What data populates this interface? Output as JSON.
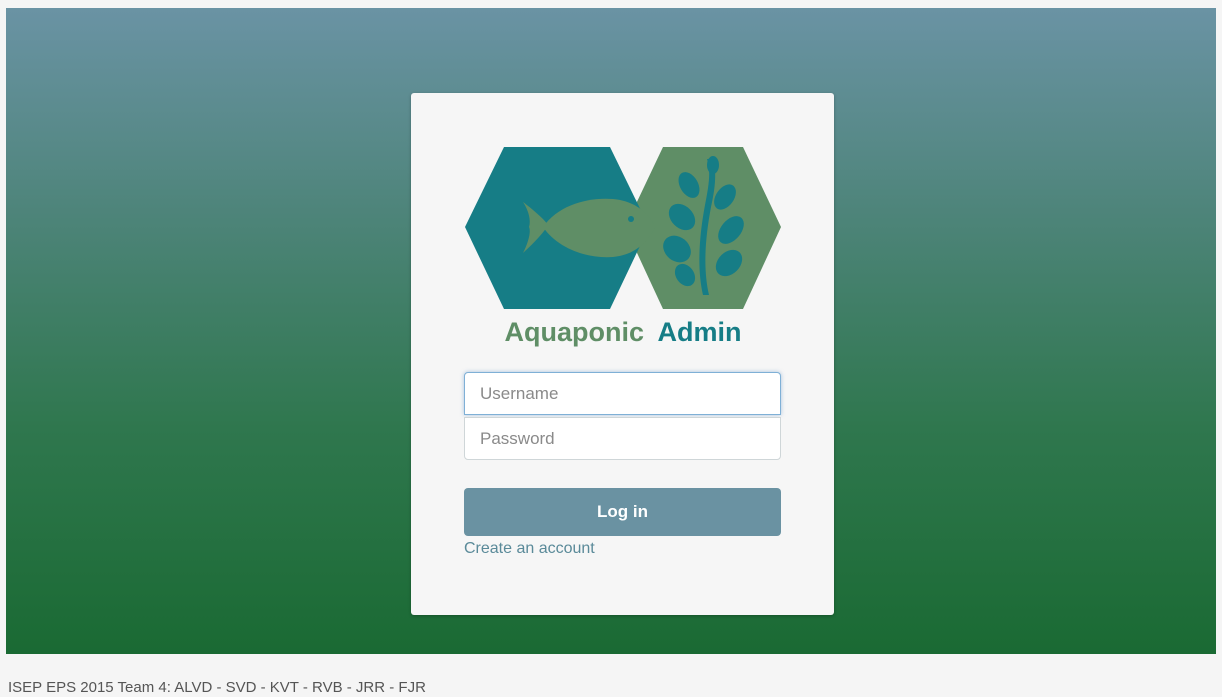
{
  "app": {
    "logo_text_part1": "Aquaponic",
    "logo_text_part2": "Admin",
    "logo_icons": [
      "fish-icon",
      "seaweed-icon"
    ]
  },
  "login_form": {
    "username_placeholder": "Username",
    "username_value": "",
    "password_placeholder": "Password",
    "password_value": "",
    "login_label": "Log in",
    "create_account_label": "Create an account"
  },
  "footer": {
    "text": "ISEP EPS 2015 Team 4: ALVD - SVD - KVT - RVB - JRR - FJR"
  },
  "colors": {
    "teal_hex": "#167d86",
    "green_hex": "#5f8e66",
    "button_bg": "#6a92a2",
    "link_color": "#5a8a99"
  }
}
